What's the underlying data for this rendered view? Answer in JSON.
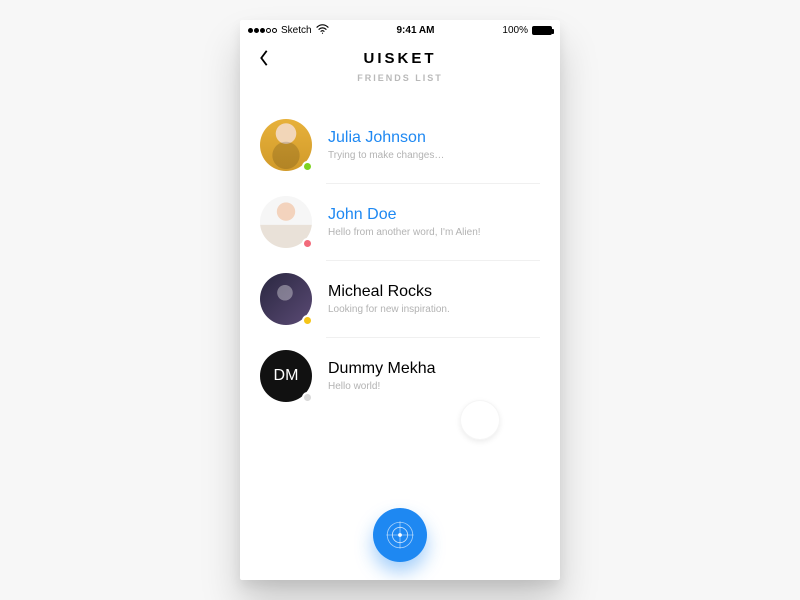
{
  "status": {
    "carrier": "Sketch",
    "time": "9:41 AM",
    "battery_pct": "100%"
  },
  "header": {
    "title": "UISKET",
    "subtitle": "FRIENDS LIST"
  },
  "colors": {
    "accent": "#1E88F2"
  },
  "friends": [
    {
      "name": "Julia Johnson",
      "subtitle": "Trying to make changes…",
      "online": true,
      "presence_color": "#7ED321",
      "initials": ""
    },
    {
      "name": "John Doe",
      "subtitle": "Hello from another word, I'm Alien!",
      "online": true,
      "presence_color": "#F26A7A",
      "initials": ""
    },
    {
      "name": "Micheal Rocks",
      "subtitle": "Looking for new inspiration.",
      "online": false,
      "presence_color": "#F5C518",
      "initials": ""
    },
    {
      "name": "Dummy Mekha",
      "subtitle": "Hello world!",
      "online": false,
      "presence_color": "#D9D9D9",
      "initials": "DM"
    }
  ],
  "fab": {
    "icon": "radar-icon"
  }
}
